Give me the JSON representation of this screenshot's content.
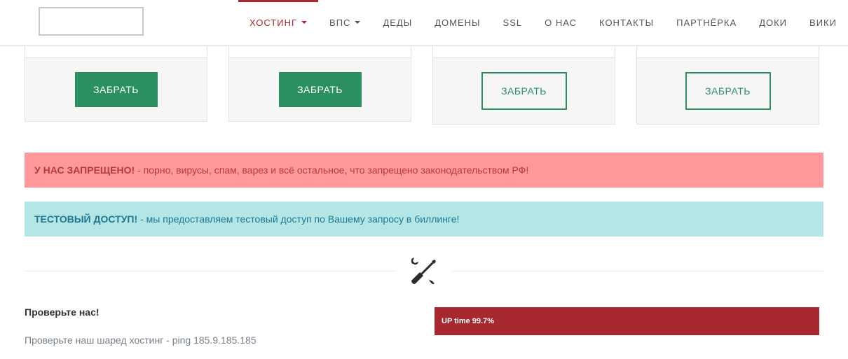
{
  "header": {
    "nav": [
      {
        "label": "ХОСТИНГ",
        "dropdown": true,
        "active": true
      },
      {
        "label": "ВПС",
        "dropdown": true,
        "active": false
      },
      {
        "label": "ДЕДЫ",
        "dropdown": false,
        "active": false
      },
      {
        "label": "ДОМЕНЫ",
        "dropdown": false,
        "active": false
      },
      {
        "label": "SSL",
        "dropdown": false,
        "active": false
      },
      {
        "label": "О НАС",
        "dropdown": false,
        "active": false
      },
      {
        "label": "КОНТАКТЫ",
        "dropdown": false,
        "active": false
      },
      {
        "label": "ПАРТНЁРКА",
        "dropdown": false,
        "active": false
      },
      {
        "label": "ДОКИ",
        "dropdown": false,
        "active": false
      },
      {
        "label": "ВИКИ",
        "dropdown": false,
        "active": false
      }
    ]
  },
  "plans": [
    {
      "button": "ЗАБРАТЬ",
      "style": "solid"
    },
    {
      "button": "ЗАБРАТЬ",
      "style": "solid"
    },
    {
      "button": "ЗАБРАТЬ",
      "style": "outline"
    },
    {
      "button": "ЗАБРАТЬ",
      "style": "outline"
    }
  ],
  "alerts": {
    "forbidden": {
      "title": "У НАС ЗАПРЕЩЕНО!",
      "text": "- порно, вирусы, спам, варез и всё остальное, что запрещено законодательством РФ!"
    },
    "test_access": {
      "title": "ТЕСТОВЫЙ ДОСТУП!",
      "text": "- мы предоставляем тестовый доступ по Вашему запросу в биллинге!"
    }
  },
  "divider": {
    "icon": "tools-icon"
  },
  "check": {
    "title": "Проверьте нас!",
    "text": "Проверьте наш шаред хостинг - ping 185.9.185.185"
  },
  "uptime": {
    "label": "UP time 99.7%",
    "percent": 100
  },
  "colors": {
    "accent_red": "#a8282f",
    "button_green": "#2a9060",
    "alert_danger_bg": "#ff9999",
    "alert_info_bg": "#b4e6e6"
  }
}
